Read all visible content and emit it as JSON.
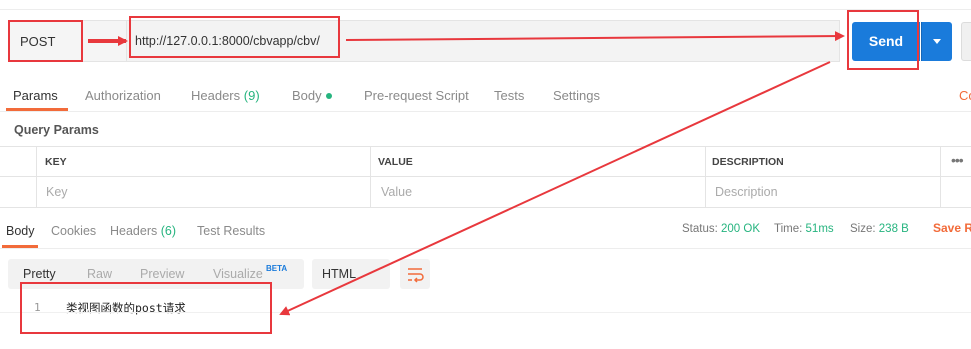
{
  "request": {
    "method": "POST",
    "url": "http://127.0.0.1:8000/cbvapp/cbv/",
    "send_label": "Send"
  },
  "request_tabs": [
    {
      "label": "Params",
      "active": true
    },
    {
      "label": "Authorization"
    },
    {
      "label": "Headers",
      "count": "(9)"
    },
    {
      "label": "Body",
      "dot": true
    },
    {
      "label": "Pre-request Script"
    },
    {
      "label": "Tests"
    },
    {
      "label": "Settings"
    }
  ],
  "cookies_edge": "Co",
  "query_params": {
    "title": "Query Params",
    "columns": [
      "KEY",
      "VALUE",
      "DESCRIPTION"
    ],
    "placeholders": [
      "Key",
      "Value",
      "Description"
    ],
    "more": "•••"
  },
  "response_tabs": [
    {
      "label": "Body",
      "active": true
    },
    {
      "label": "Cookies"
    },
    {
      "label": "Headers",
      "count": "(6)"
    },
    {
      "label": "Test Results"
    }
  ],
  "status": {
    "status_label": "Status:",
    "status_value": "200 OK",
    "time_label": "Time:",
    "time_value": "51ms",
    "size_label": "Size:",
    "size_value": "238 B",
    "save_label": "Save R"
  },
  "format_tabs": [
    {
      "label": "Pretty",
      "active": true
    },
    {
      "label": "Raw"
    },
    {
      "label": "Preview"
    },
    {
      "label": "Visualize"
    }
  ],
  "beta_badge": "BETA",
  "language": "HTML",
  "response_body": {
    "line_number": "1",
    "text": "类视图函数的post请求"
  },
  "annotation_color": "#e8383d",
  "accent_color": "#f26b3a",
  "send_color": "#1a7bdb",
  "icons": [
    "chevron-down-icon",
    "wrap-lines-icon"
  ]
}
